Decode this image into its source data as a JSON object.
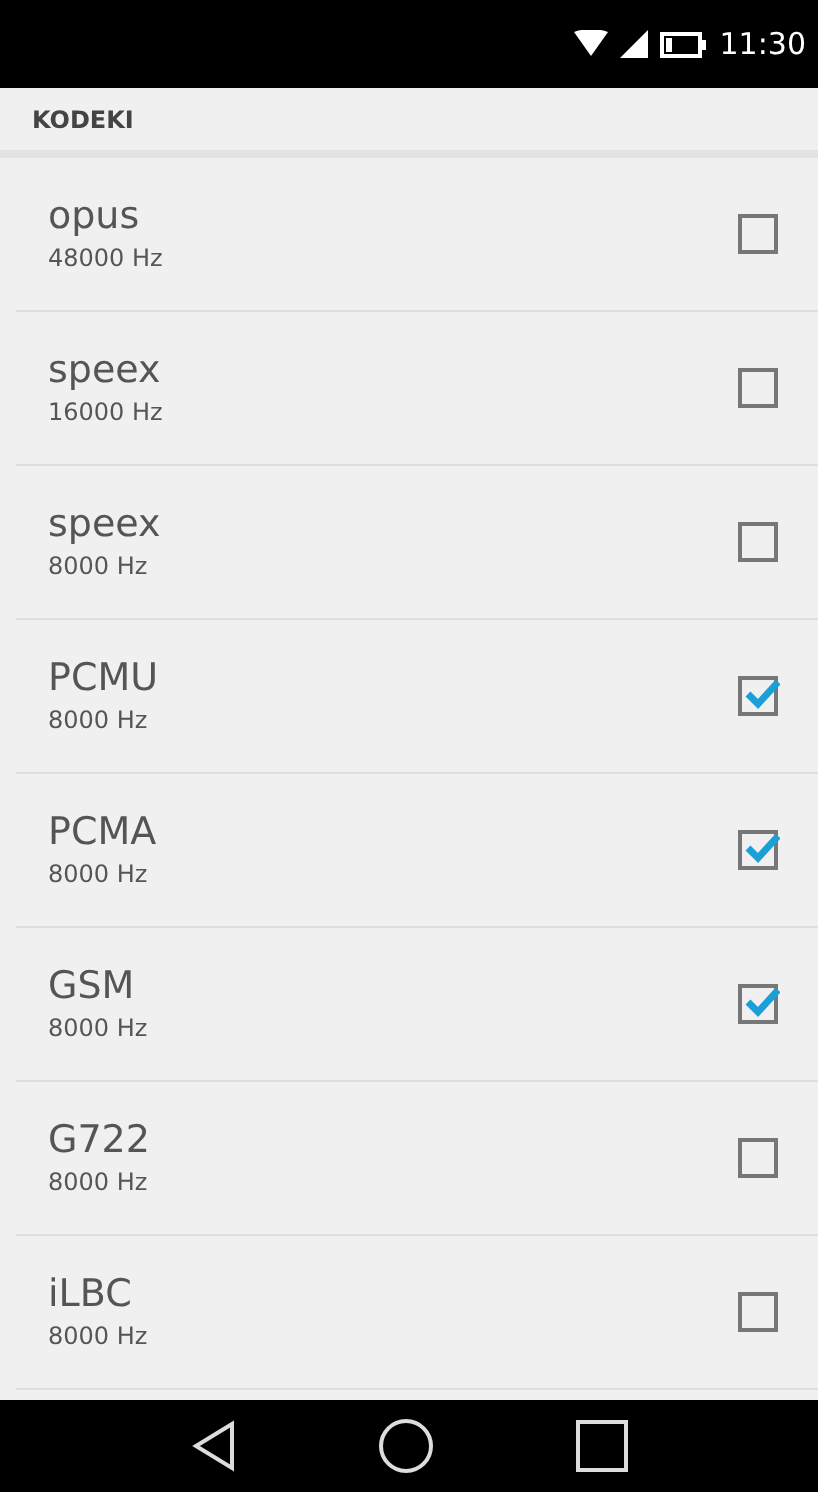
{
  "status_bar": {
    "time": "11:30"
  },
  "section": {
    "title": "KODEKI"
  },
  "codecs": [
    {
      "name": "opus",
      "rate": "48000 Hz",
      "checked": false
    },
    {
      "name": "speex",
      "rate": "16000 Hz",
      "checked": false
    },
    {
      "name": "speex",
      "rate": "8000 Hz",
      "checked": false
    },
    {
      "name": "PCMU",
      "rate": "8000 Hz",
      "checked": true
    },
    {
      "name": "PCMA",
      "rate": "8000 Hz",
      "checked": true
    },
    {
      "name": "GSM",
      "rate": "8000 Hz",
      "checked": true
    },
    {
      "name": "G722",
      "rate": "8000 Hz",
      "checked": false
    },
    {
      "name": "iLBC",
      "rate": "8000 Hz",
      "checked": false
    }
  ]
}
